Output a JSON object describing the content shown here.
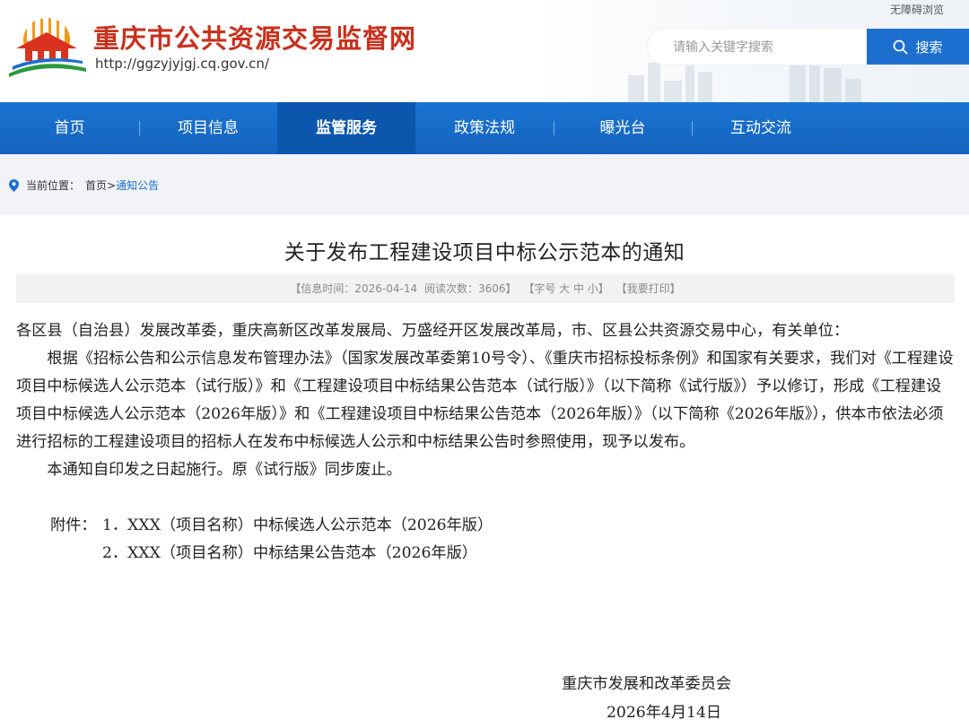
{
  "header": {
    "site_title": "重庆市公共资源交易监督网",
    "site_url": "http://ggzyjyjgj.cq.gov.cn/",
    "accessibility_link": "无障碍浏览",
    "search": {
      "placeholder": "请输入关键字搜索",
      "button_label": "搜索"
    }
  },
  "nav": {
    "items": [
      {
        "label": "首页"
      },
      {
        "label": "项目信息"
      },
      {
        "label": "监管服务"
      },
      {
        "label": "政策法规"
      },
      {
        "label": "曝光台"
      },
      {
        "label": "互动交流"
      }
    ]
  },
  "breadcrumb": {
    "prefix": "当前位置：",
    "home": "首页",
    "separator": ">",
    "current": "通知公告"
  },
  "article": {
    "title": "关于发布工程建设项目中标公示范本的通知",
    "meta": {
      "date": "【信息时间：2026-04-14",
      "views": "阅读次数：3606】",
      "font_size": "【字号 大 中 小】",
      "print": "【我要打印】"
    },
    "salutation": "各区县（自治县）发展改革委，重庆高新区改革发展局、万盛经开区发展改革局，市、区县公共资源交易中心，有关单位：",
    "paragraph1": "根据《招标公告和公示信息发布管理办法》（国家发展改革委第10号令）、《重庆市招标投标条例》和国家有关要求，我们对《工程建设项目中标候选人公示范本（试行版）》和《工程建设项目中标结果公告范本（试行版）》（以下简称《试行版》）予以修订，形成《工程建设项目中标候选人公示范本（2026年版）》和《工程建设项目中标结果公告范本（2026年版）》（以下简称《2026年版》），供本市依法必须进行招标的工程建设项目的招标人在发布中标候选人公示和中标结果公告时参照使用，现予以发布。",
    "paragraph2": "本通知自印发之日起施行。原《试行版》同步废止。",
    "attachments_label": "附件：",
    "attachment1": "1．XXX（项目名称）中标候选人公示范本（2026年版）",
    "attachment2": "2．XXX（项目名称）中标结果公告范本（2026年版）",
    "signature": "重庆市发展和改革委员会",
    "date_signed": "2026年4月14日"
  }
}
